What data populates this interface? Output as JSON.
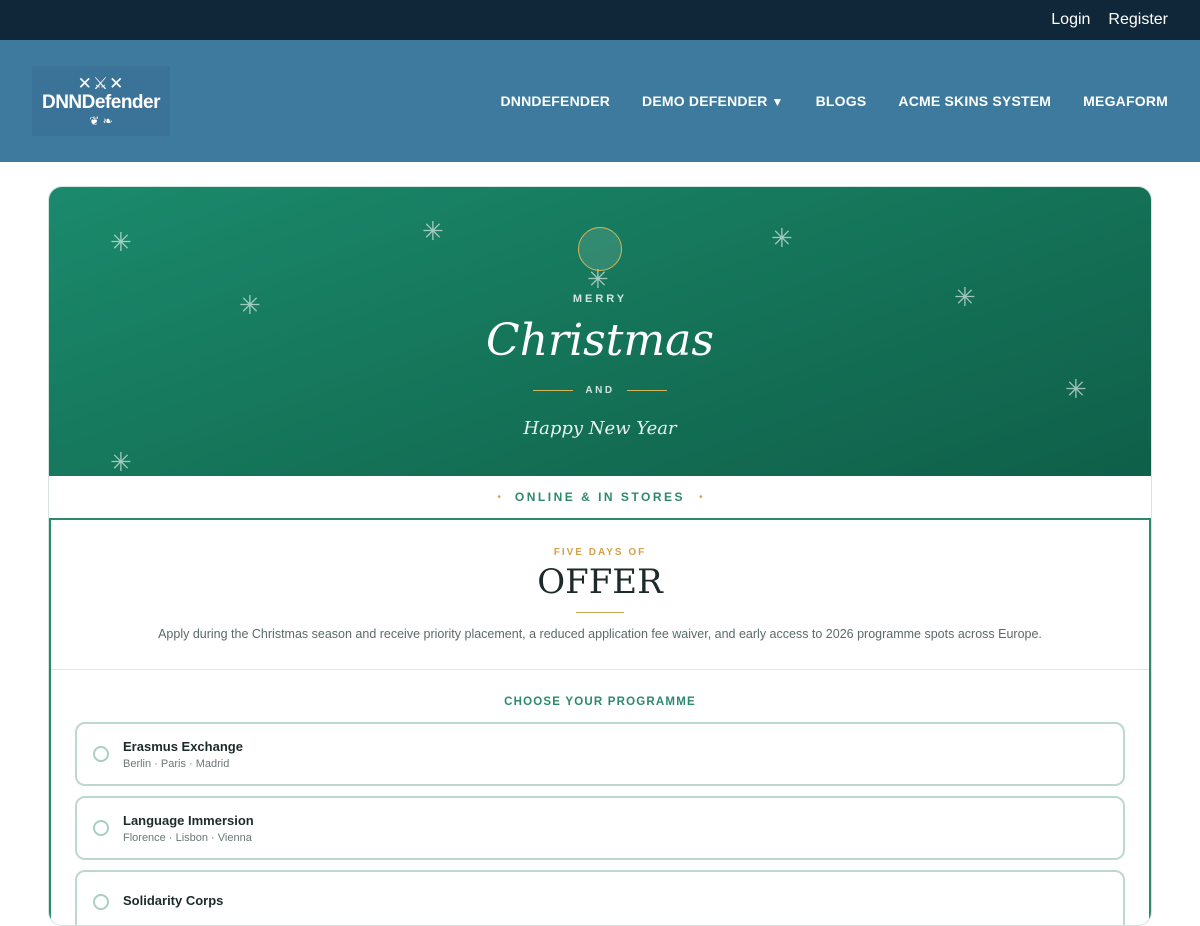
{
  "topbar": {
    "login": "Login",
    "register": "Register"
  },
  "logo": {
    "text": "DNNDefender",
    "mark": "✕⚔✕",
    "laurel": "❦ ❧"
  },
  "nav": {
    "items": [
      "DNNDEFENDER",
      "DEMO DEFENDER",
      "BLOGS",
      "ACME SKINS SYSTEM",
      "MEGAFORM"
    ],
    "caret": "▼"
  },
  "hero": {
    "merry": "MERRY",
    "title": "Christmas",
    "and": "AND",
    "subtitle": "Happy New Year",
    "star_glyph": "✳"
  },
  "strip": {
    "text": "ONLINE & IN STORES",
    "dot": "•"
  },
  "offer": {
    "kicker": "FIVE DAYS OF",
    "title": "OFFER",
    "description": "Apply during the Christmas season and receive priority placement, a reduced application fee waiver, and early access to 2026 programme spots across Europe."
  },
  "programmes": {
    "heading": "CHOOSE YOUR PROGRAMME",
    "items": [
      {
        "name": "Erasmus Exchange",
        "cities": "Berlin · Paris · Madrid"
      },
      {
        "name": "Language Immersion",
        "cities": "Florence · Lisbon · Vienna"
      },
      {
        "name": "Solidarity Corps",
        "cities": ""
      }
    ]
  },
  "colors": {
    "topbar": "#10273a",
    "navbar": "#3d7a9e",
    "hero": "#17805f",
    "accent": "#2b8a6e",
    "gold": "#d4a24c"
  }
}
